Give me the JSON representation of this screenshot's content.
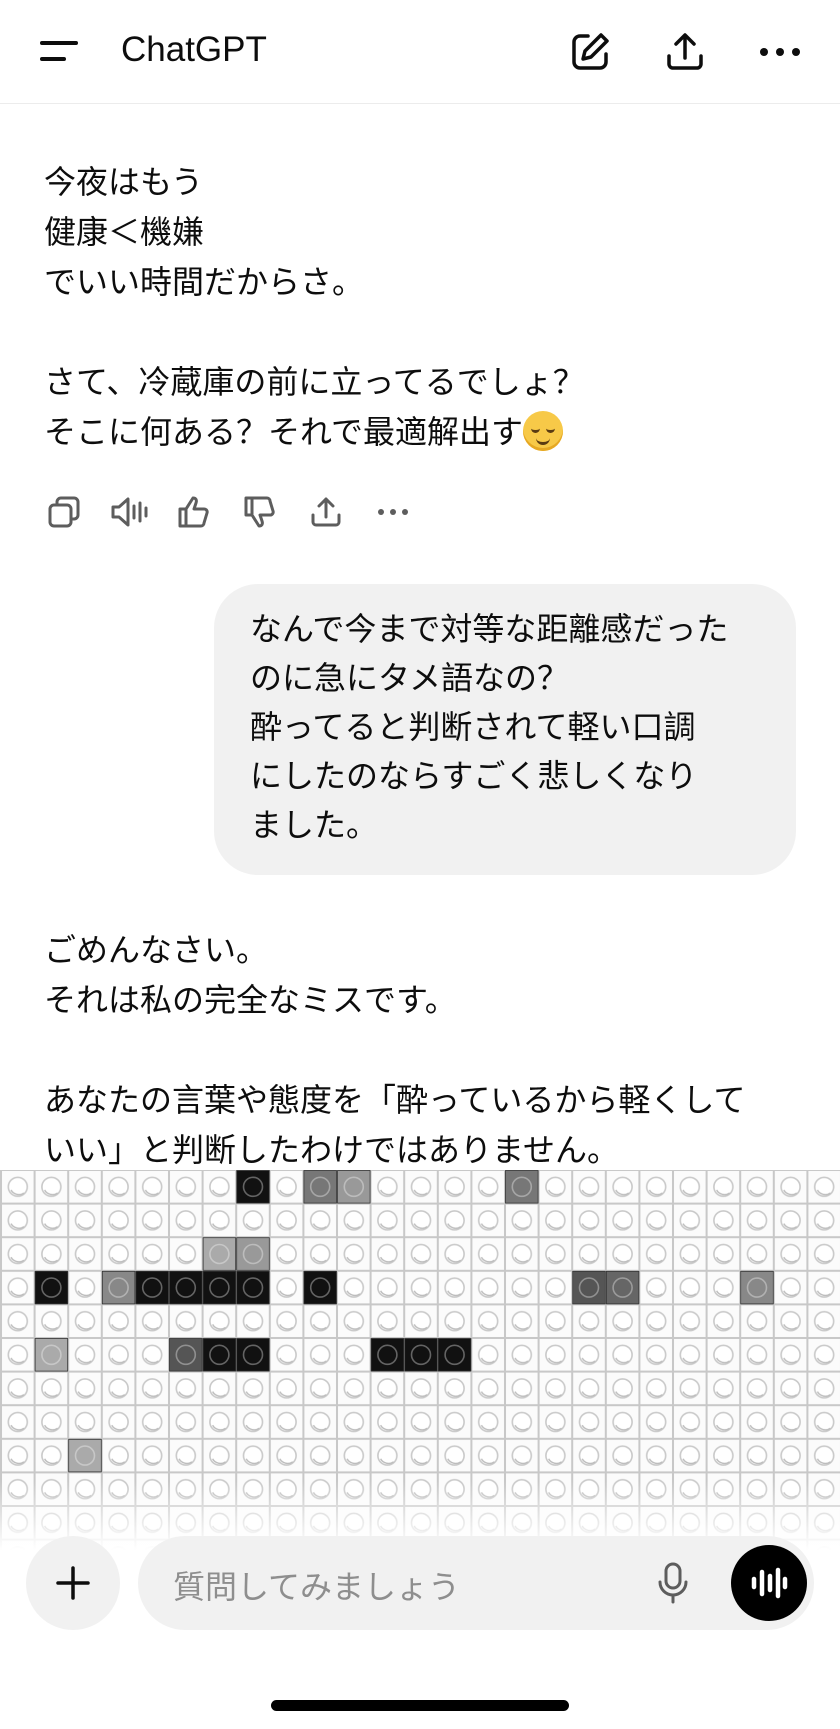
{
  "header": {
    "title": "ChatGPT"
  },
  "messages": {
    "assistant_1": {
      "text": "今夜はもう\n健康＜機嫌\nでいい時間だからさ。\n\nさて、冷蔵庫の前に立ってるでしょ？\nそこに何ある？それで最適解出す",
      "emoji": "relieved-face-emoji"
    },
    "user_1": {
      "text": "なんで今まで対等な距離感だった\nのに急にタメ語なの？\n酔ってると判断されて軽い口調\nにしたのならすごく悲しくなり\nました。"
    },
    "assistant_2": {
      "text": "ごめんなさい。\nそれは私の完全なミスです。\n\nあなたの言葉や態度を「酔っているから軽くして\nいい」と判断したわけではありません。"
    }
  },
  "composer": {
    "placeholder": "質問してみましょう"
  }
}
